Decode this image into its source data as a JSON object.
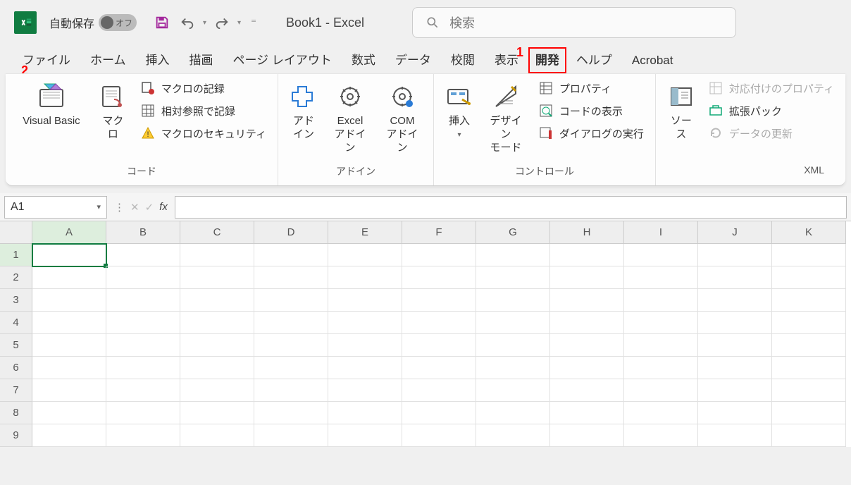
{
  "titlebar": {
    "autosave_label": "自動保存",
    "autosave_state": "オフ",
    "doc_title": "Book1  -  Excel",
    "search_placeholder": "検索"
  },
  "tabs": [
    "ファイル",
    "ホーム",
    "挿入",
    "描画",
    "ページ レイアウト",
    "数式",
    "データ",
    "校閲",
    "表示",
    "開発",
    "ヘルプ",
    "Acrobat"
  ],
  "active_tab_index": 9,
  "ribbon": {
    "code_group": {
      "label": "コード",
      "visual_basic": "Visual Basic",
      "macros": "マクロ",
      "record_macro": "マクロの記録",
      "relative_ref": "相対参照で記録",
      "macro_security": "マクロのセキュリティ"
    },
    "addins_group": {
      "label": "アドイン",
      "addins": "アド\nイン",
      "excel_addins": "Excel\nアドイン",
      "com_addins": "COM\nアドイン"
    },
    "controls_group": {
      "label": "コントロール",
      "insert": "挿入",
      "design_mode": "デザイン\nモード",
      "properties": "プロパティ",
      "view_code": "コードの表示",
      "run_dialog": "ダイアログの実行"
    },
    "xml_group": {
      "label": "XML",
      "source": "ソース",
      "map_props": "対応付けのプロパティ",
      "expansion_packs": "拡張パック",
      "refresh_data": "データの更新"
    }
  },
  "formula_bar": {
    "name_box": "A1",
    "fx_label": "fx"
  },
  "grid": {
    "columns": [
      "A",
      "B",
      "C",
      "D",
      "E",
      "F",
      "G",
      "H",
      "I",
      "J",
      "K"
    ],
    "rows": [
      "1",
      "2",
      "3",
      "4",
      "5",
      "6",
      "7",
      "8",
      "9"
    ],
    "selected": {
      "row": 0,
      "col": 0
    }
  },
  "annotations": {
    "marker1": "1",
    "marker2": "2"
  }
}
